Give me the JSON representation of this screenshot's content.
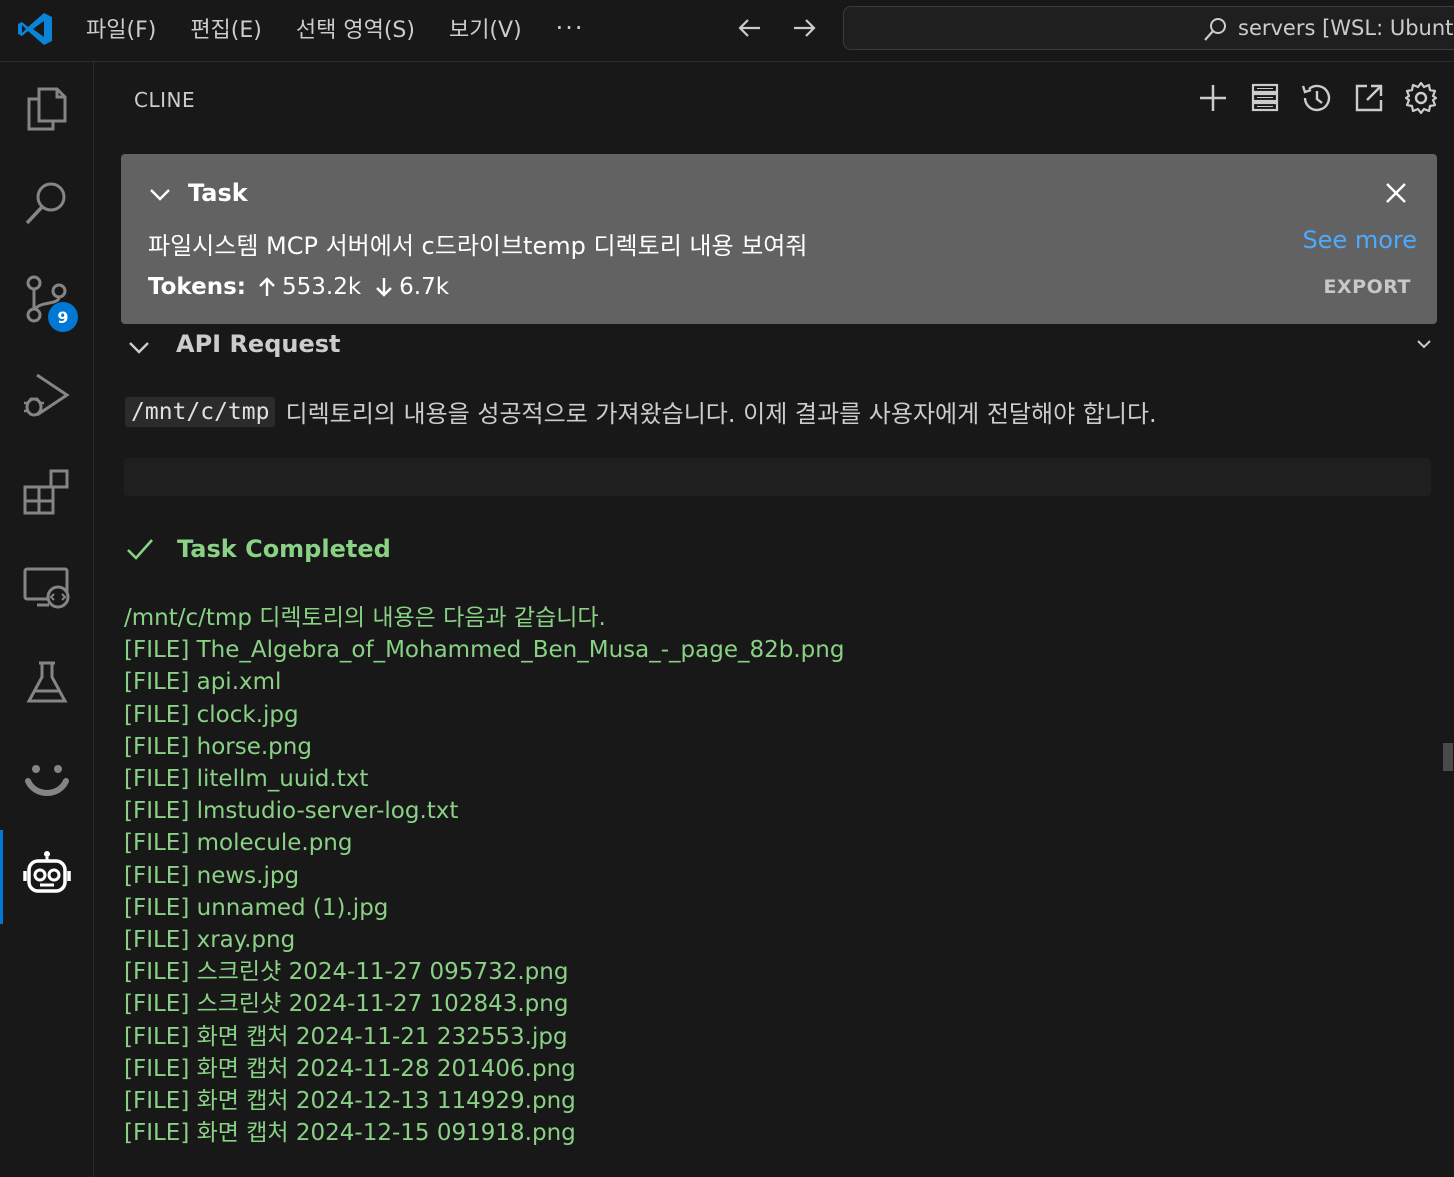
{
  "titlebar": {
    "menu": [
      "파일(F)",
      "편집(E)",
      "선택 영역(S)",
      "보기(V)"
    ],
    "more": "···",
    "command_center": "servers [WSL: Ubuntu"
  },
  "activity": {
    "scm_badge": "9"
  },
  "panel": {
    "title": "CLINE"
  },
  "task": {
    "label": "Task",
    "text": "파일시스템 MCP 서버에서 c드라이브temp 디렉토리 내용 보여줘",
    "see_more": "See more",
    "tokens_label": "Tokens:",
    "tokens_in": "553.2k",
    "tokens_out": "6.7k",
    "export": "EXPORT"
  },
  "api_request": {
    "label": "API Request"
  },
  "status": {
    "code": "/mnt/c/tmp",
    "text": "디렉토리의 내용을 성공적으로 가져왔습니다. 이제 결과를 사용자에게 전달해야 합니다."
  },
  "completed": {
    "label": "Task Completed",
    "intro": "/mnt/c/tmp 디렉토리의 내용은 다음과 같습니다.",
    "files": [
      "[FILE] The_Algebra_of_Mohammed_Ben_Musa_-_page_82b.png",
      "[FILE] api.xml",
      "[FILE] clock.jpg",
      "[FILE] horse.png",
      "[FILE] litellm_uuid.txt",
      "[FILE] lmstudio-server-log.txt",
      "[FILE] molecule.png",
      "[FILE] news.jpg",
      "[FILE] unnamed (1).jpg",
      "[FILE] xray.png",
      "[FILE] 스크린샷 2024-11-27 095732.png",
      "[FILE] 스크린샷 2024-11-27 102843.png",
      "[FILE] 화면 캡처 2024-11-21 232553.jpg",
      "[FILE] 화면 캡처 2024-11-28 201406.png",
      "[FILE] 화면 캡처 2024-12-13 114929.png",
      "[FILE] 화면 캡처 2024-12-15 091918.png"
    ]
  },
  "colors": {
    "accent": "#0078d4",
    "success": "#89d185",
    "link": "#4daafc",
    "task_card": "#626262"
  }
}
